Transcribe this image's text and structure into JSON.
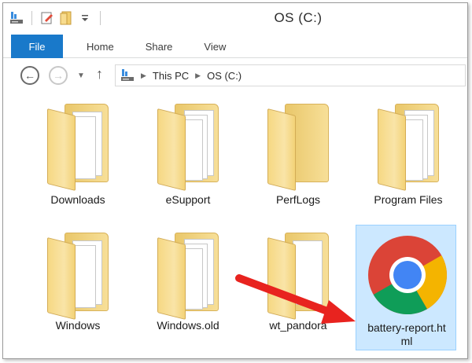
{
  "window": {
    "title": "OS (C:)"
  },
  "ribbon": {
    "tabs": [
      {
        "label": "File",
        "active": true
      },
      {
        "label": "Home"
      },
      {
        "label": "Share"
      },
      {
        "label": "View"
      }
    ]
  },
  "navigation": {
    "breadcrumb": [
      "This PC",
      "OS (C:)"
    ]
  },
  "files": [
    {
      "name": "Downloads",
      "type": "folder"
    },
    {
      "name": "eSupport",
      "type": "folder"
    },
    {
      "name": "PerfLogs",
      "type": "folder"
    },
    {
      "name": "Program Files",
      "type": "folder"
    },
    {
      "name": "Windows",
      "type": "folder"
    },
    {
      "name": "Windows.old",
      "type": "folder"
    },
    {
      "name": "wt_pandora",
      "type": "folder"
    },
    {
      "name": "battery-report.html",
      "type": "html",
      "selected": true,
      "label_lines": [
        "battery-report.ht",
        "ml"
      ]
    }
  ],
  "colors": {
    "accent": "#1979ca",
    "selection_bg": "#cce8ff",
    "arrow": "#e8231f"
  }
}
